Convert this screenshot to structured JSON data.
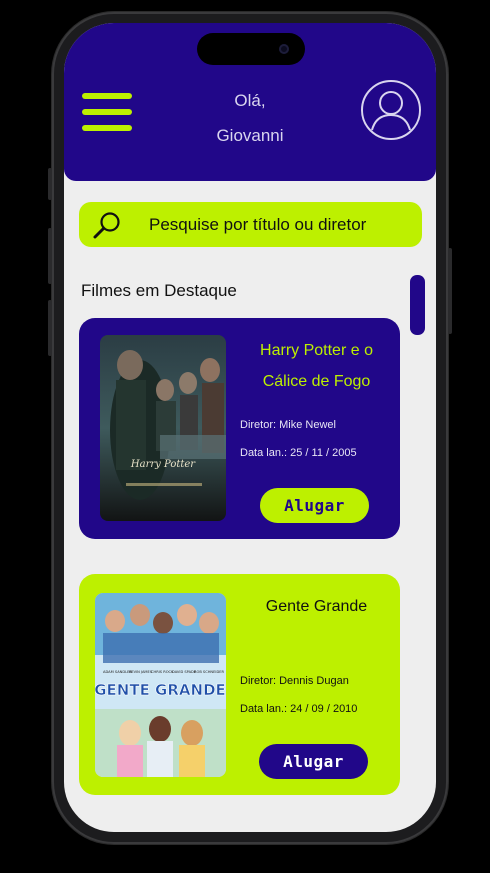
{
  "header": {
    "greeting_line1": "Olá,",
    "greeting_line2": "Giovanni"
  },
  "search": {
    "placeholder": "Pesquise por título ou diretor"
  },
  "section_title": "Filmes em Destaque",
  "movies": [
    {
      "title_line1": "Harry Potter e o",
      "title_line2": "Cálice de Fogo",
      "director": "Diretor:  Mike Newel",
      "release": "Data lan.: 25 / 11 / 2005",
      "button": "Alugar",
      "poster_text": "Harry Potter"
    },
    {
      "title": "Gente Grande",
      "director": "Diretor:  Dennis Dugan",
      "release": "Data lan.: 24 / 09 / 2010",
      "button": "Alugar",
      "poster_text": "GENTE GRANDE",
      "poster_cast": [
        "ADAM SANDLER",
        "KEVIN JAMES",
        "CHRIS ROCK",
        "DAVID SPADE",
        "ROB SCHNEIDER"
      ]
    }
  ],
  "colors": {
    "primary": "#210789",
    "accent": "#bdf000",
    "background": "#eeeeee"
  },
  "icons": [
    "hamburger-menu-icon",
    "user-avatar-icon",
    "search-icon"
  ]
}
